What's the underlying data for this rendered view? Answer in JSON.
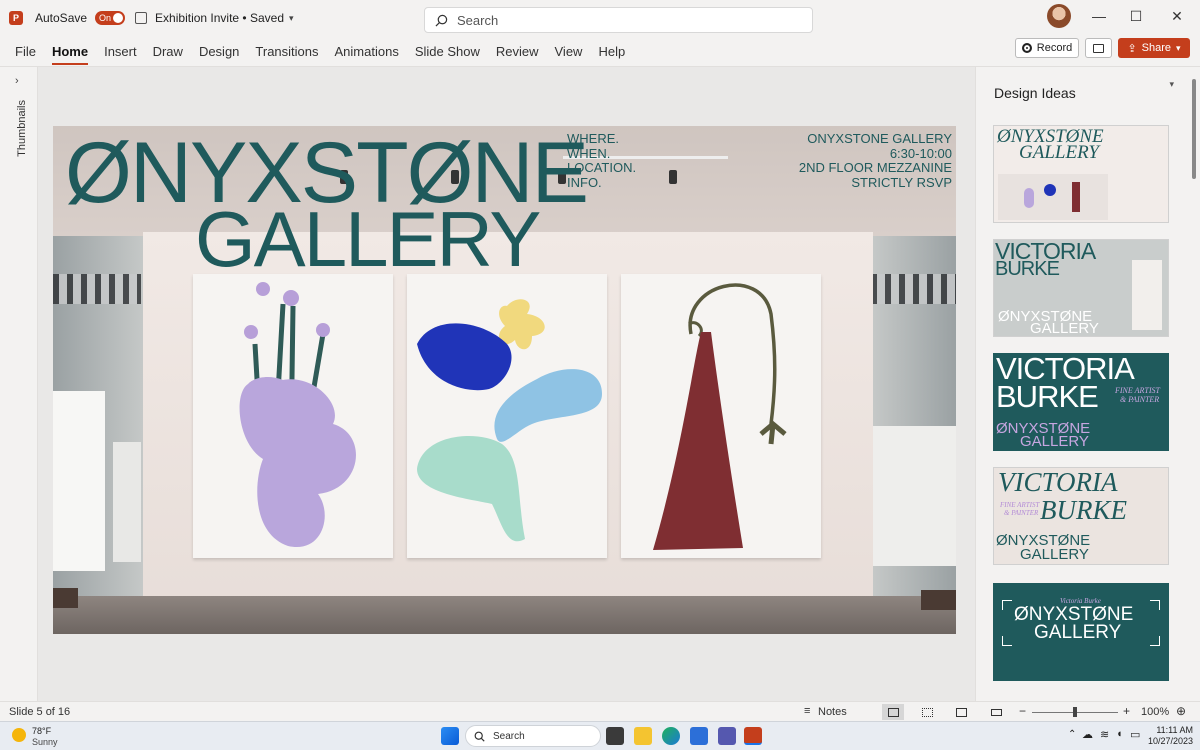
{
  "titlebar": {
    "app_icon": "P",
    "autosave_label": "AutoSave",
    "autosave_state": "On",
    "document_title": "Exhibition Invite • Saved",
    "search_placeholder": "Search",
    "window_controls": [
      "—",
      "☐",
      "✕"
    ]
  },
  "ribbon": {
    "tabs": [
      "File",
      "Home",
      "Insert",
      "Draw",
      "Design",
      "Transitions",
      "Animations",
      "Slide Show",
      "Review",
      "View",
      "Help"
    ],
    "active_tab": "Home",
    "record_label": "Record",
    "share_label": "Share",
    "accent_color": "#c43e1c"
  },
  "thumbnails_rail": {
    "arrow": "›",
    "label": "Thumbnails"
  },
  "slide": {
    "title_line1": "ØNYXSTØNE",
    "title_line2": "GALLERY",
    "info_labels": [
      "WHERE.",
      "WHEN.",
      "LOCATION.",
      "INFO."
    ],
    "info_values": [
      "ONYXSTONE GALLERY",
      "6:30-10:00",
      "2ND FLOOR MEZZANINE",
      "STRICTLY RSVP"
    ],
    "title_color": "#1f5a5c"
  },
  "design_ideas": {
    "heading": "Design Ideas",
    "ideas": [
      {
        "lines": [
          "ØNYXSTØNE",
          "GALLERY"
        ]
      },
      {
        "lines": [
          "VICTORIA",
          "BURKE",
          "ØNYXSTØNE",
          "GALLERY"
        ]
      },
      {
        "lines": [
          "VICTORIA",
          "BURKE",
          "FINE ARTIST",
          "& PAINTER",
          "ØNYXSTØNE",
          "GALLERY"
        ]
      },
      {
        "lines": [
          "VICTORIA",
          "BURKE",
          "FINE ARTIST",
          "& PAINTER",
          "ØNYXSTØNE",
          "GALLERY"
        ]
      },
      {
        "lines": [
          "Victoria Burke",
          "ØNYXSTØNE",
          "GALLERY"
        ]
      }
    ]
  },
  "statusbar": {
    "slide_count": "Slide 5 of 16",
    "notes_label": "Notes",
    "zoom": "100%",
    "zoom_minus": "−",
    "zoom_plus": "+"
  },
  "taskbar": {
    "weather_temp": "78°F",
    "weather_desc": "Sunny",
    "search_label": "Search",
    "time": "11:11 AM",
    "date": "10/27/2023"
  }
}
